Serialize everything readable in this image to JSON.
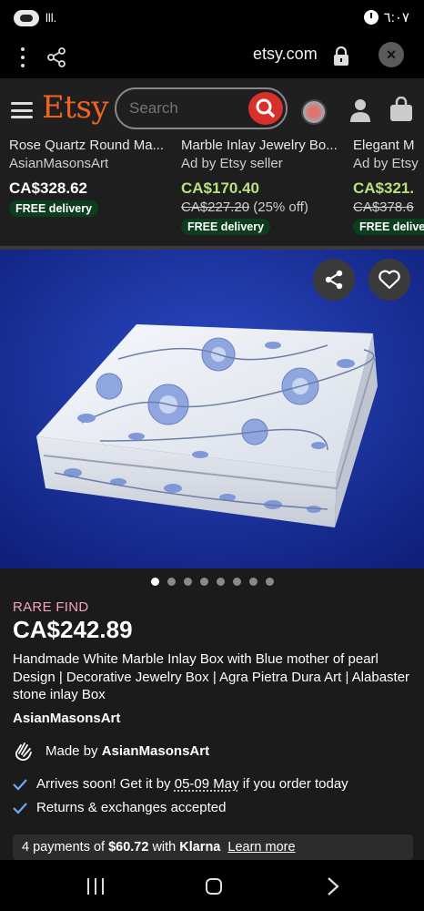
{
  "status_bar": {
    "time": "٦:٠٧",
    "signal": "lll."
  },
  "browser": {
    "url": "etsy.com",
    "close_label": "×"
  },
  "header": {
    "logo": "Etsy",
    "search_placeholder": "Search"
  },
  "carousel": {
    "cards": [
      {
        "title": "Rose Quartz Round Ma...",
        "seller": "AsianMasonsArt",
        "price": "CA$328.62",
        "original_price": "",
        "discount": "",
        "badge": "FREE delivery",
        "price_color": "#ffffff"
      },
      {
        "title": "Marble Inlay Jewelry Bo...",
        "seller": "Ad by Etsy seller",
        "price": "CA$170.40",
        "original_price": "CA$227.20",
        "discount": "(25% off)",
        "badge": "FREE delivery",
        "price_color": "#b8e07f"
      },
      {
        "title": "Elegant M",
        "seller": "Ad by Etsy",
        "price": "CA$321.",
        "original_price": "CA$378.6",
        "discount": "",
        "badge": "FREE delive",
        "price_color": "#b8e07f"
      }
    ]
  },
  "gallery": {
    "image_count": 8,
    "active_index": 0
  },
  "product": {
    "tag": "RARE FIND",
    "price": "CA$242.89",
    "title": "Handmade White Marble Inlay Box with Blue mother of pearl Design | Decorative Jewelry Box | Agra Pietra Dura Art | Alabaster stone inlay Box",
    "shop": "AsianMasonsArt",
    "made_by_prefix": "Made by",
    "made_by_shop": "AsianMasonsArt",
    "arrival_prefix": "Arrives soon! Get it by",
    "arrival_dates": "05-09 May",
    "arrival_suffix": "if you order today",
    "returns": "Returns & exchanges accepted"
  },
  "klarna": {
    "prefix": "4 payments of",
    "amount": "$60.72",
    "with": "with",
    "brand": "Klarna",
    "learn_more": "Learn more"
  },
  "colors": {
    "accent": "#f1641e",
    "search_button": "#d6312b",
    "rare_find": "#f5a3b8",
    "check": "#6aa9f7",
    "badge_bg": "#0d3d1f"
  }
}
